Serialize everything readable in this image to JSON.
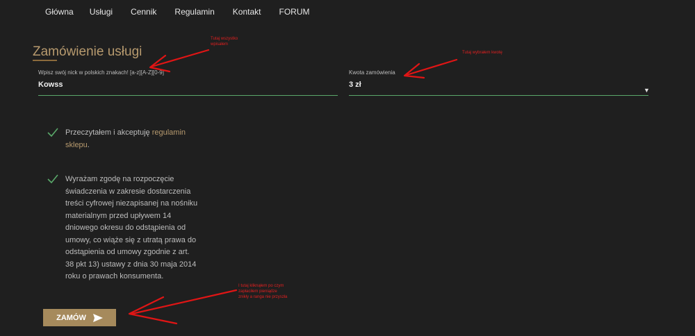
{
  "nav": [
    "Główna",
    "Usługi",
    "Cennik",
    "Regulamin",
    "Kontakt",
    "FORUM"
  ],
  "form": {
    "title": "Zamówienie usługi",
    "nick_label": "Wpisz swój nick w polskich znakach! [a-z][A-Z][0-9]",
    "nick_value": "Kowss",
    "amount_label": "Kwota zamówienia",
    "amount_value": "3 zł",
    "consent1": {
      "line1_text": "Przeczytałem i akceptuję ",
      "line1_link": "regulamin",
      "line2_link": "sklepu",
      "line2_tail": "."
    },
    "consent2_lines": [
      "Wyrażam zgodę na rozpoczęcie",
      "świadczenia w zakresie dostarczenia",
      "treści cyfrowej niezapisanej na nośniku",
      "materialnym przed upływem 14",
      "dniowego okresu do odstąpienia od",
      "umowy, co wiąże się z utratą prawa do",
      "odstąpienia od umowy zgodnie z art.",
      "38 pkt 13) ustawy z dnia 30 maja 2014",
      "roku o prawach konsumenta."
    ],
    "submit_label": "ZAMÓW"
  },
  "annotations": {
    "a1": [
      "Tutaj wszystko",
      "wpisałem"
    ],
    "a2": [
      "Tutaj wybrałem kwotę"
    ],
    "a3": [
      "I tutaj kliknąłem po czym",
      "zapłaciłem pieniądze",
      "znikły a ranga nie przyszła"
    ]
  },
  "colors": {
    "accent": "#b79a6e",
    "button": "#a68a5c",
    "input_line": "#5aa86a",
    "annotation": "#e02020"
  }
}
